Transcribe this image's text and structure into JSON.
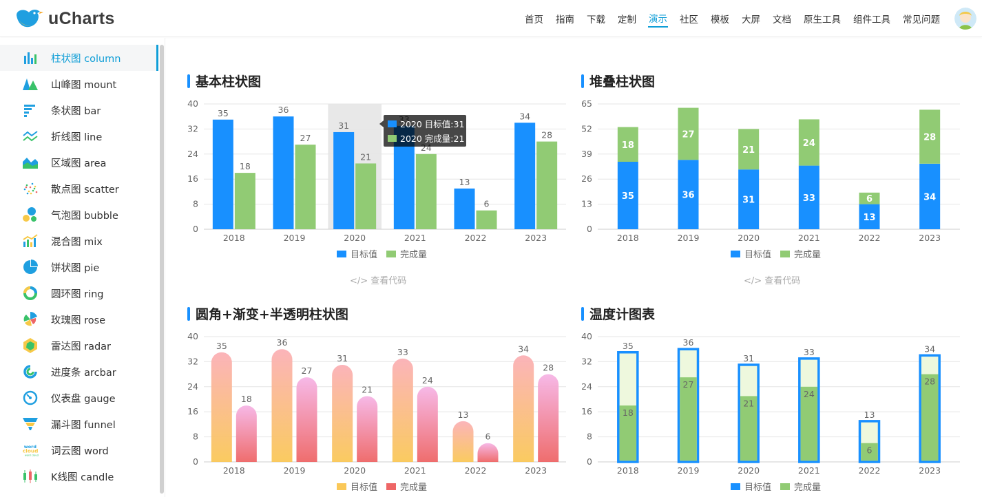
{
  "app": {
    "name": "uCharts",
    "nav": [
      "首页",
      "指南",
      "下载",
      "定制",
      "演示",
      "社区",
      "模板",
      "大屏",
      "文档",
      "原生工具",
      "组件工具",
      "常见问题"
    ],
    "active_nav": "演示"
  },
  "sidebar": {
    "active_index": 0,
    "items": [
      {
        "label": "柱状图  column",
        "icon": "column-chart-icon"
      },
      {
        "label": "山峰图  mount",
        "icon": "mountain-chart-icon"
      },
      {
        "label": "条状图  bar",
        "icon": "bar-chart-icon"
      },
      {
        "label": "折线图  line",
        "icon": "line-chart-icon"
      },
      {
        "label": "区域图  area",
        "icon": "area-chart-icon"
      },
      {
        "label": "散点图  scatter",
        "icon": "scatter-chart-icon"
      },
      {
        "label": "气泡图  bubble",
        "icon": "bubble-chart-icon"
      },
      {
        "label": "混合图  mix",
        "icon": "mix-chart-icon"
      },
      {
        "label": "饼状图  pie",
        "icon": "pie-chart-icon"
      },
      {
        "label": "圆环图  ring",
        "icon": "ring-chart-icon"
      },
      {
        "label": "玫瑰图  rose",
        "icon": "rose-chart-icon"
      },
      {
        "label": "雷达图  radar",
        "icon": "radar-chart-icon"
      },
      {
        "label": "进度条  arcbar",
        "icon": "arcbar-chart-icon"
      },
      {
        "label": "仪表盘  gauge",
        "icon": "gauge-chart-icon"
      },
      {
        "label": "漏斗图  funnel",
        "icon": "funnel-chart-icon"
      },
      {
        "label": "词云图  word",
        "icon": "word-cloud-icon"
      },
      {
        "label": "K线图  candle",
        "icon": "candle-chart-icon"
      }
    ]
  },
  "panels": {
    "p1_title": "基本柱状图",
    "p2_title": "堆叠柱状图",
    "p3_title": "圆角+渐变+半透明柱状图",
    "p4_title": "温度计图表",
    "code_link": "</> 查看代码"
  },
  "tooltip": {
    "lines": [
      "2020 目标值:31",
      "2020 完成量:21"
    ]
  },
  "colors": {
    "accent": "#0f9ed7",
    "blue": "#1890FF",
    "green": "#91CB74",
    "yellow": "#FAC858",
    "red": "#EE6666"
  },
  "chart_data": [
    {
      "id": "basic",
      "type": "bar",
      "title": "基本柱状图",
      "categories": [
        "2018",
        "2019",
        "2020",
        "2021",
        "2022",
        "2023"
      ],
      "series": [
        {
          "name": "目标值",
          "values": [
            35,
            36,
            31,
            33,
            13,
            34
          ]
        },
        {
          "name": "完成量",
          "values": [
            18,
            27,
            21,
            24,
            6,
            28
          ]
        }
      ],
      "yticks": [
        0,
        8,
        16,
        24,
        32,
        40
      ],
      "ylim": [
        0,
        40
      ],
      "legend": "bottom",
      "highlight_category": "2020"
    },
    {
      "id": "stacked",
      "type": "bar",
      "stacked": true,
      "title": "堆叠柱状图",
      "categories": [
        "2018",
        "2019",
        "2020",
        "2021",
        "2022",
        "2023"
      ],
      "series": [
        {
          "name": "目标值",
          "values": [
            35,
            36,
            31,
            33,
            13,
            34
          ]
        },
        {
          "name": "完成量",
          "values": [
            18,
            27,
            21,
            24,
            6,
            28
          ]
        }
      ],
      "yticks": [
        0,
        13,
        26,
        39,
        52,
        65
      ],
      "ylim": [
        0,
        65
      ],
      "legend": "bottom"
    },
    {
      "id": "rounded",
      "type": "bar",
      "title": "圆角+渐变+半透明柱状图",
      "categories": [
        "2018",
        "2019",
        "2020",
        "2021",
        "2022",
        "2023"
      ],
      "series": [
        {
          "name": "目标值",
          "values": [
            35,
            36,
            31,
            33,
            13,
            34
          ]
        },
        {
          "name": "完成量",
          "values": [
            18,
            27,
            21,
            24,
            6,
            28
          ]
        }
      ],
      "yticks": [
        0,
        8,
        16,
        24,
        32,
        40
      ],
      "ylim": [
        0,
        40
      ],
      "legend": "bottom"
    },
    {
      "id": "thermo",
      "type": "bar",
      "title": "温度计图表",
      "categories": [
        "2018",
        "2019",
        "2020",
        "2021",
        "2022",
        "2023"
      ],
      "series": [
        {
          "name": "目标值",
          "values": [
            35,
            36,
            31,
            33,
            13,
            34
          ]
        },
        {
          "name": "完成量",
          "values": [
            18,
            27,
            21,
            24,
            6,
            28
          ]
        }
      ],
      "yticks": [
        0,
        8,
        16,
        24,
        32,
        40
      ],
      "ylim": [
        0,
        40
      ],
      "legend": "bottom"
    }
  ]
}
